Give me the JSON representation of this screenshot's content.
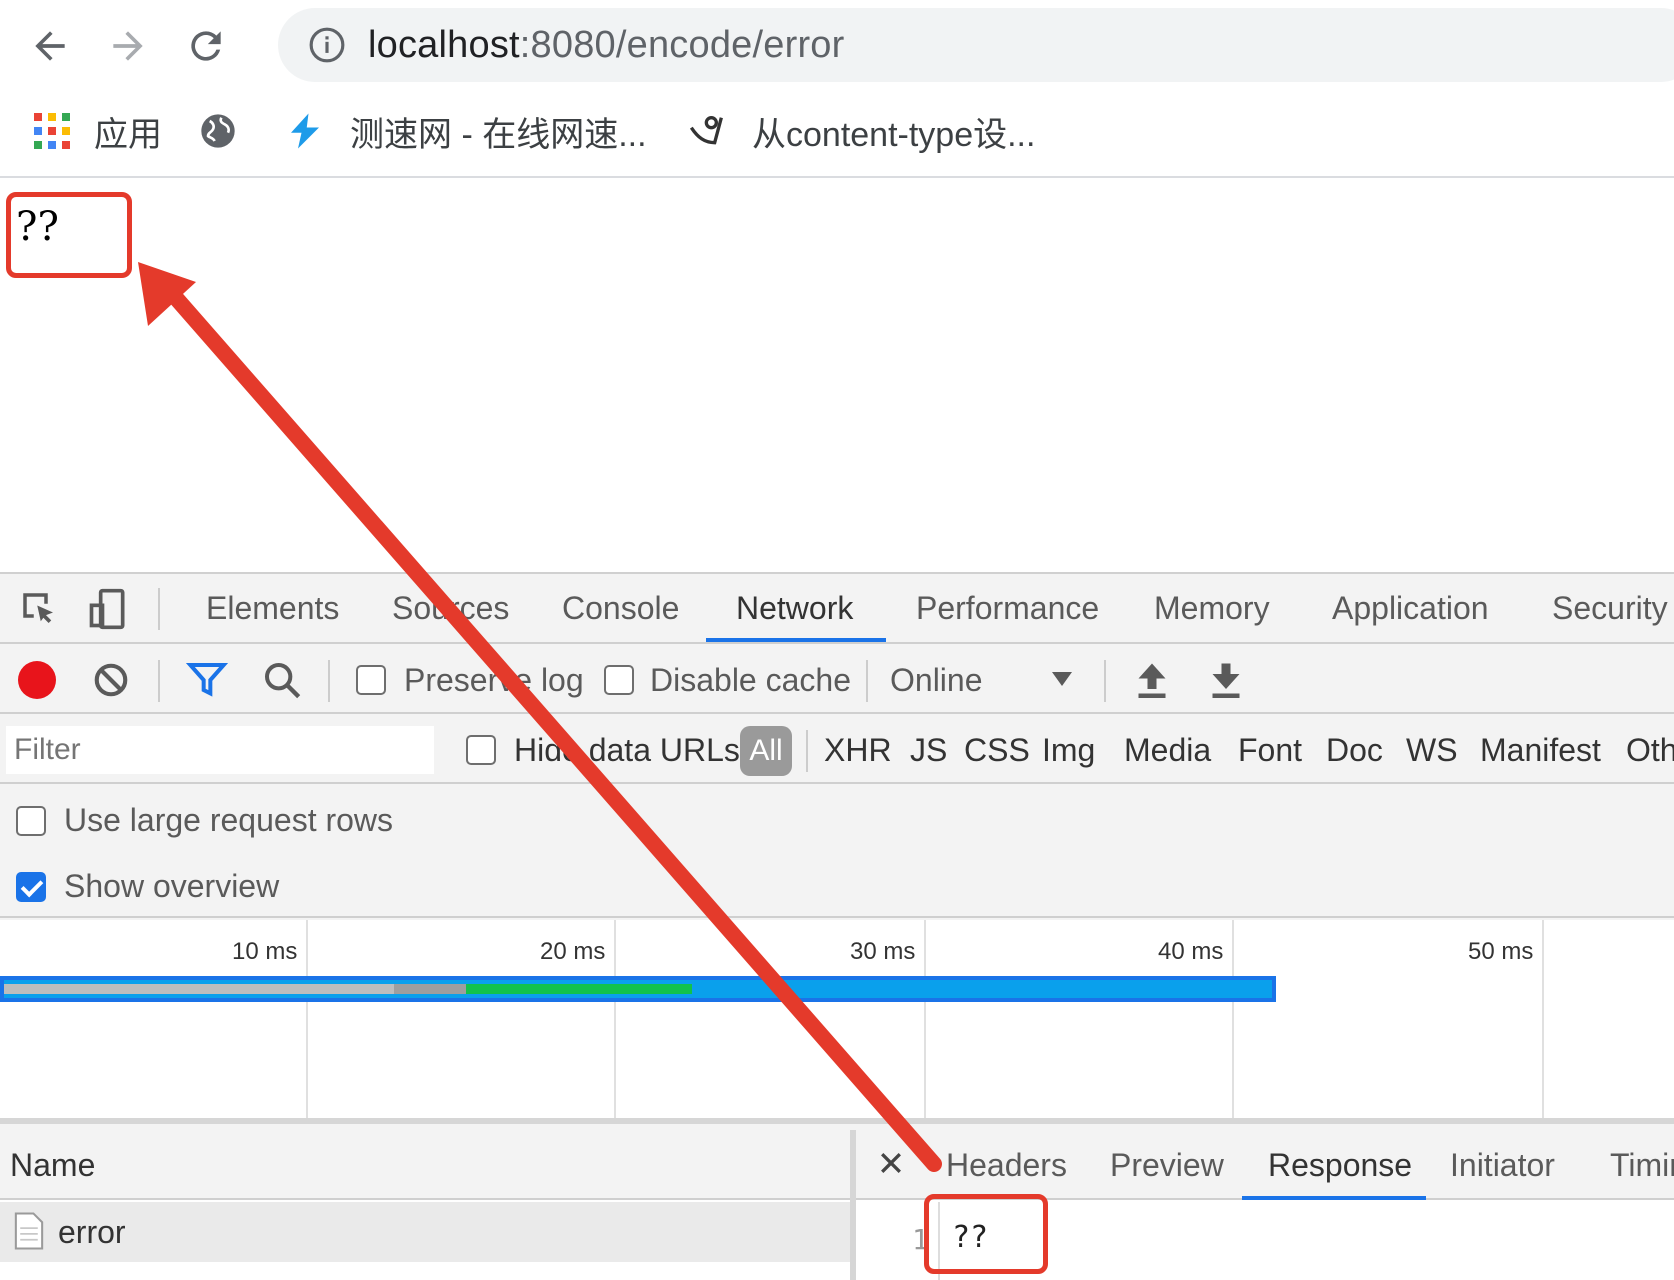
{
  "browser": {
    "url_host": "localhost",
    "url_rest": ":8080/encode/error",
    "bookmarks": [
      {
        "label": "应用",
        "icon": "apps-grid-icon"
      },
      {
        "label": "",
        "icon": "globe-icon"
      },
      {
        "label": "测速网 - 在线网速...",
        "icon": "speedtest-logo-icon"
      },
      {
        "label": "从content-type设...",
        "icon": "site-logo-icon"
      }
    ]
  },
  "page": {
    "body_text": "??"
  },
  "devtools": {
    "tabs": [
      "Elements",
      "Sources",
      "Console",
      "Network",
      "Performance",
      "Memory",
      "Application",
      "Security"
    ],
    "active_tab": "Network",
    "toolbar": {
      "preserve_log": "Preserve log",
      "disable_cache": "Disable cache",
      "throttle": "Online"
    },
    "filter": {
      "placeholder": "Filter",
      "hide_data_urls": "Hide data URLs",
      "all": "All",
      "types": [
        "XHR",
        "JS",
        "CSS",
        "Img",
        "Media",
        "Font",
        "Doc",
        "WS",
        "Manifest",
        "Other"
      ]
    },
    "settings": {
      "large_rows": "Use large request rows",
      "show_overview": "Show overview",
      "large_rows_checked": false,
      "show_overview_checked": true
    },
    "overview": {
      "ticks": [
        "10 ms",
        "20 ms",
        "30 ms",
        "40 ms",
        "50 ms"
      ]
    },
    "requests": {
      "column_name": "Name",
      "rows": [
        {
          "name": "error"
        }
      ]
    },
    "detail": {
      "tabs": [
        "Headers",
        "Preview",
        "Response",
        "Initiator",
        "Timing"
      ],
      "active_tab": "Response",
      "line_number": "1",
      "response_text": "??"
    }
  },
  "colors": {
    "accent": "#1a73e8",
    "record": "#e8141b",
    "annotation": "#e43a2b"
  }
}
